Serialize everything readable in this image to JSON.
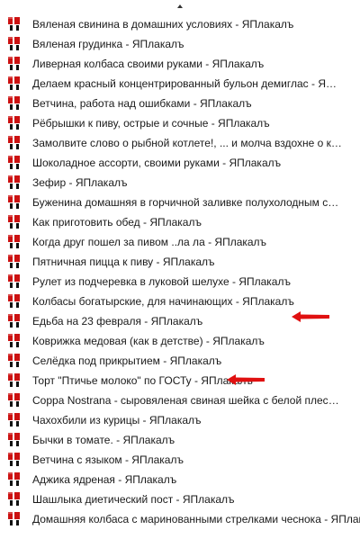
{
  "menu": {
    "items": [
      {
        "label": "Вяленая свинина в домашних условиях - ЯПлакалъ"
      },
      {
        "label": "Вяленая грудинка - ЯПлакалъ"
      },
      {
        "label": "Ливерная колбаса своими руками - ЯПлакалъ"
      },
      {
        "label": "Делаем красный концентрированный бульон демиглас - ЯПлакалъ"
      },
      {
        "label": "Ветчина, работа над ошибками - ЯПлакалъ"
      },
      {
        "label": "Рёбрышки к пиву, острые и сочные - ЯПлакалъ"
      },
      {
        "label": "Замолвите слово о рыбной котлете!, ... и молча вздохне о кнелях - ЯПлакалъ"
      },
      {
        "label": "Шоколадное ассорти, своими руками - ЯПлакалъ"
      },
      {
        "label": "Зефир - ЯПлакалъ"
      },
      {
        "label": "Буженина домашняя в горчичной заливке полухолодным способом"
      },
      {
        "label": "Как приготовить обед - ЯПлакалъ"
      },
      {
        "label": "Когда друг пошел за пивом ..ла ла - ЯПлакалъ"
      },
      {
        "label": "Пятничная пицца к пиву - ЯПлакалъ"
      },
      {
        "label": "Рулет из подчеревка в луковой шелухе - ЯПлакалъ"
      },
      {
        "label": "Колбасы богатырские, для начинающих - ЯПлакалъ"
      },
      {
        "label": "Едьба на 23 февраля - ЯПлакалъ"
      },
      {
        "label": "Коврижка медовая (как в детстве) - ЯПлакалъ"
      },
      {
        "label": "Селёдка под прикрытием - ЯПлакалъ"
      },
      {
        "label": "Торт \"Птичье молоко\" по ГОСТу - ЯПлакалъ"
      },
      {
        "label": "Coppa Nostrana - сыровяленая свиная шейка с белой плесенью"
      },
      {
        "label": "Чахохбили из курицы - ЯПлакалъ"
      },
      {
        "label": "Бычки в томате. - ЯПлакалъ"
      },
      {
        "label": "Ветчина с языком - ЯПлакалъ"
      },
      {
        "label": "Аджика ядреная - ЯПлакалъ"
      },
      {
        "label": "Шашлыка диетический пост - ЯПлакалъ"
      },
      {
        "label": "Домашняя колбаса с маринованными стрелками чеснока - ЯПлакалъ"
      }
    ],
    "favicon_color": "#cc1111",
    "arrow_color": "#e01010",
    "highlighted_items": [
      14,
      17
    ]
  }
}
